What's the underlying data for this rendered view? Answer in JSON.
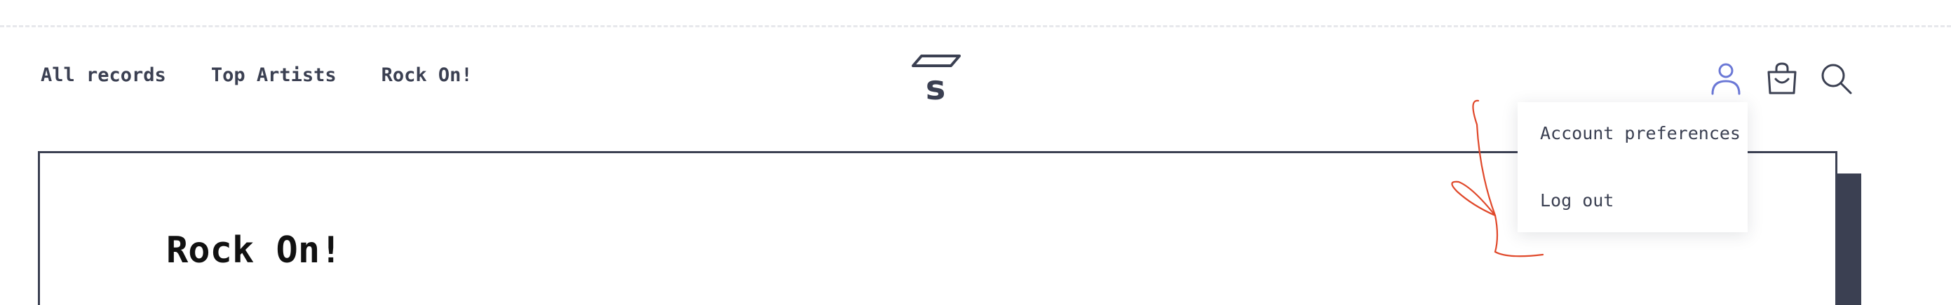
{
  "nav": {
    "items": [
      {
        "label": "All records"
      },
      {
        "label": "Top Artists"
      },
      {
        "label": "Rock On!"
      }
    ]
  },
  "header": {
    "logo_letter": "s",
    "icons": {
      "user": "user-icon",
      "bag": "shopping-bag-icon",
      "search": "search-icon"
    }
  },
  "account_menu": {
    "items": [
      {
        "label": "Account preferences"
      },
      {
        "label": "Log out"
      }
    ]
  },
  "main": {
    "title": "Rock On!"
  },
  "colors": {
    "text": "#3b4052",
    "accent_user_icon": "#6b78d6",
    "annotation": "#e0482a",
    "title": "#111111"
  }
}
